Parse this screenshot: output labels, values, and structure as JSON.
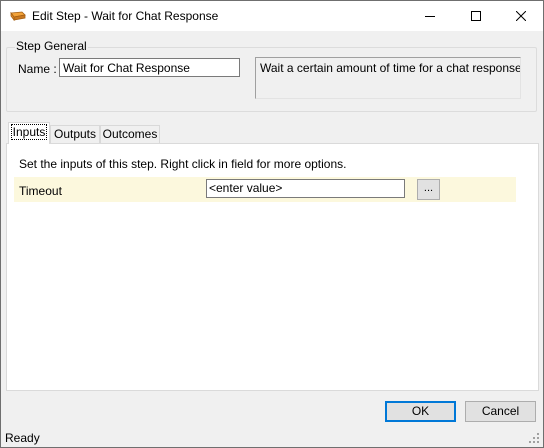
{
  "window": {
    "title": "Edit Step - Wait for Chat Response",
    "icon": "app-icon"
  },
  "step_general": {
    "legend": "Step General",
    "name_label": "Name :",
    "name_value": "Wait for Chat Response",
    "description": "Wait a certain amount of time for a chat response."
  },
  "tabs": [
    {
      "label": "Inputs",
      "active": true
    },
    {
      "label": "Outputs",
      "active": false
    },
    {
      "label": "Outcomes",
      "active": false
    }
  ],
  "inputs_panel": {
    "hint": "Set the inputs of this step.  Right click in field for more options.",
    "rows": [
      {
        "label": "Timeout",
        "value": "<enter value>",
        "button": "..."
      }
    ],
    "row_highlight_color": "#fcf8dd"
  },
  "buttons": {
    "ok": "OK",
    "cancel": "Cancel"
  },
  "status": {
    "text": "Ready"
  },
  "colors": {
    "accent": "#0078d7",
    "window_bg": "#f0f0f0"
  }
}
